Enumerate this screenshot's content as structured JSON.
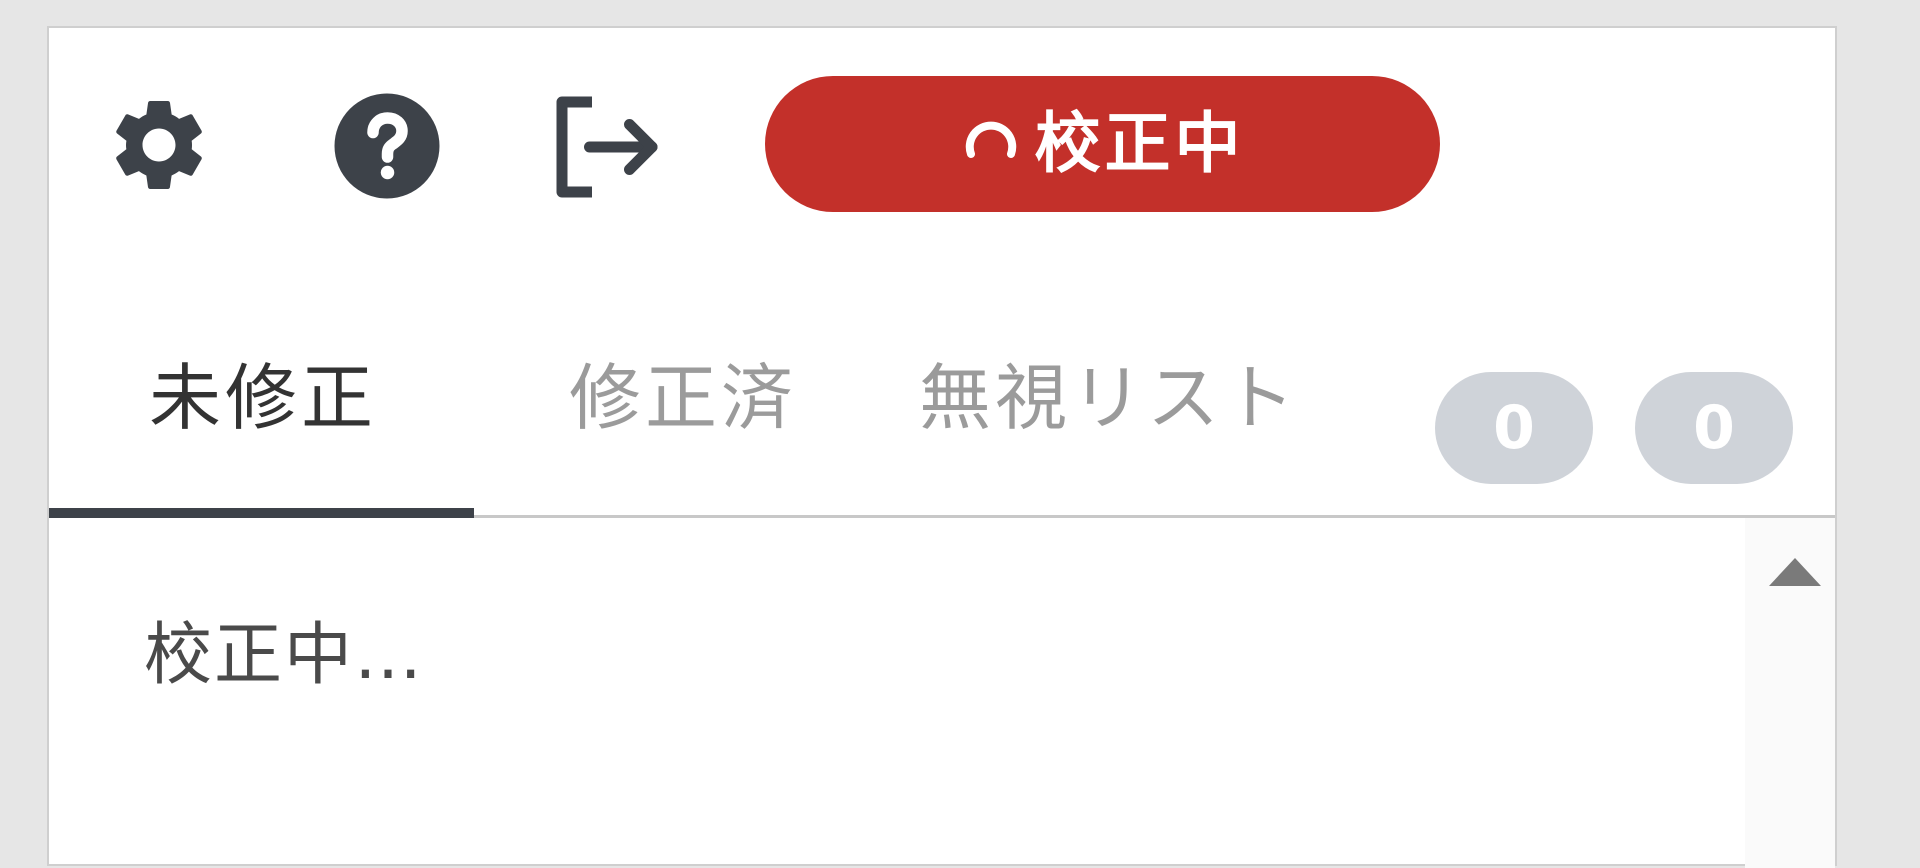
{
  "toolbar": {
    "icons": [
      "gear-icon",
      "help-icon",
      "logout-icon"
    ],
    "status": {
      "label": "校正中",
      "icon": "spinner-icon",
      "color": "#c3302a"
    }
  },
  "tabs": [
    {
      "label": "未修正",
      "active": true
    },
    {
      "label": "修正済",
      "active": false
    },
    {
      "label": "無視リスト",
      "active": false
    }
  ],
  "badges": [
    "0",
    "0"
  ],
  "content": {
    "message": "校正中…"
  }
}
